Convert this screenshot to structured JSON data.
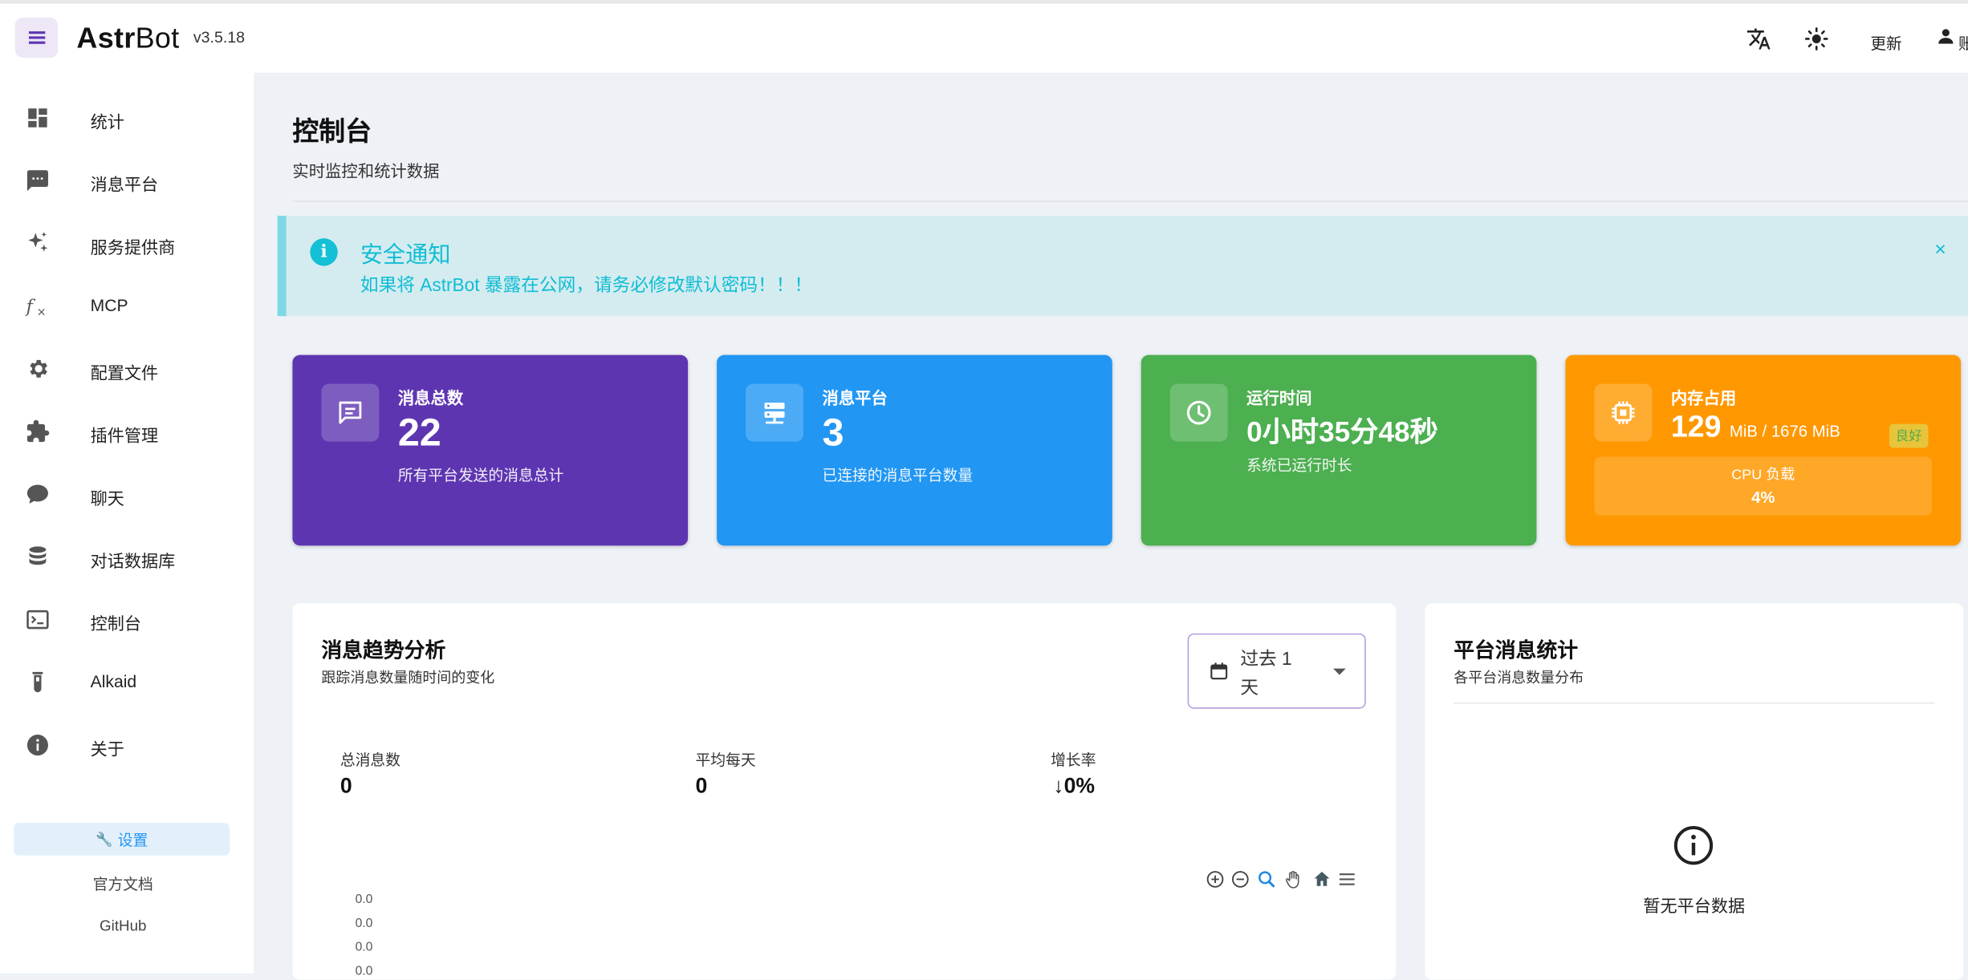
{
  "header": {
    "brand_bold": "Astr",
    "brand_rest": "Bot",
    "version": "v3.5.18",
    "update_label": "更新",
    "account_label": "账"
  },
  "sidebar": {
    "items": [
      {
        "label": "统计",
        "icon": "dashboard-icon"
      },
      {
        "label": "消息平台",
        "icon": "message-dots-icon"
      },
      {
        "label": "服务提供商",
        "icon": "sparkles-icon"
      },
      {
        "label": "MCP",
        "icon": "function-icon"
      },
      {
        "label": "配置文件",
        "icon": "gear-icon"
      },
      {
        "label": "插件管理",
        "icon": "puzzle-icon"
      },
      {
        "label": "聊天",
        "icon": "chat-bubble-icon"
      },
      {
        "label": "对话数据库",
        "icon": "database-icon"
      },
      {
        "label": "控制台",
        "icon": "console-icon"
      },
      {
        "label": "Alkaid",
        "icon": "test-tube-icon"
      },
      {
        "label": "关于",
        "icon": "info-icon"
      }
    ],
    "settings_label": "设置",
    "docs_label": "官方文档",
    "github_label": "GitHub"
  },
  "page": {
    "title": "控制台",
    "subtitle": "实时监控和统计数据"
  },
  "alert": {
    "title": "安全通知",
    "message": "如果将 AstrBot 暴露在公网，请务必修改默认密码！！！",
    "close": "×"
  },
  "cards": {
    "messages": {
      "title": "消息总数",
      "value": "22",
      "desc": "所有平台发送的消息总计",
      "color": "#5e35b1"
    },
    "platforms": {
      "title": "消息平台",
      "value": "3",
      "desc": "已连接的消息平台数量",
      "color": "#2196f3"
    },
    "uptime": {
      "title": "运行时间",
      "value": "0小时35分48秒",
      "desc": "系统已运行时长",
      "color": "#4caf50"
    },
    "memory": {
      "title": "内存占用",
      "value": "129",
      "unit": "MiB / 1676 MiB",
      "badge": "良好",
      "cpu_label": "CPU 负载",
      "cpu_value": "4%",
      "color": "#ff9800"
    }
  },
  "trend": {
    "title": "消息趋势分析",
    "subtitle": "跟踪消息数量随时间的变化",
    "range_value": "过去 1 天",
    "stats": {
      "total_label": "总消息数",
      "total_value": "0",
      "avg_label": "平均每天",
      "avg_value": "0",
      "growth_label": "增长率",
      "growth_value": "0%"
    },
    "toolbar": [
      "zoom-in-icon",
      "zoom-out-icon",
      "magnifier-icon",
      "pan-hand-icon",
      "home-icon",
      "menu-icon"
    ]
  },
  "chart_data": {
    "type": "line",
    "title": "",
    "y_tick_labels": [
      "0.0",
      "0.0",
      "0.0",
      "0.0"
    ],
    "series": [],
    "x": []
  },
  "platform_stats": {
    "title": "平台消息统计",
    "subtitle": "各平台消息数量分布",
    "empty_text": "暂无平台数据"
  }
}
